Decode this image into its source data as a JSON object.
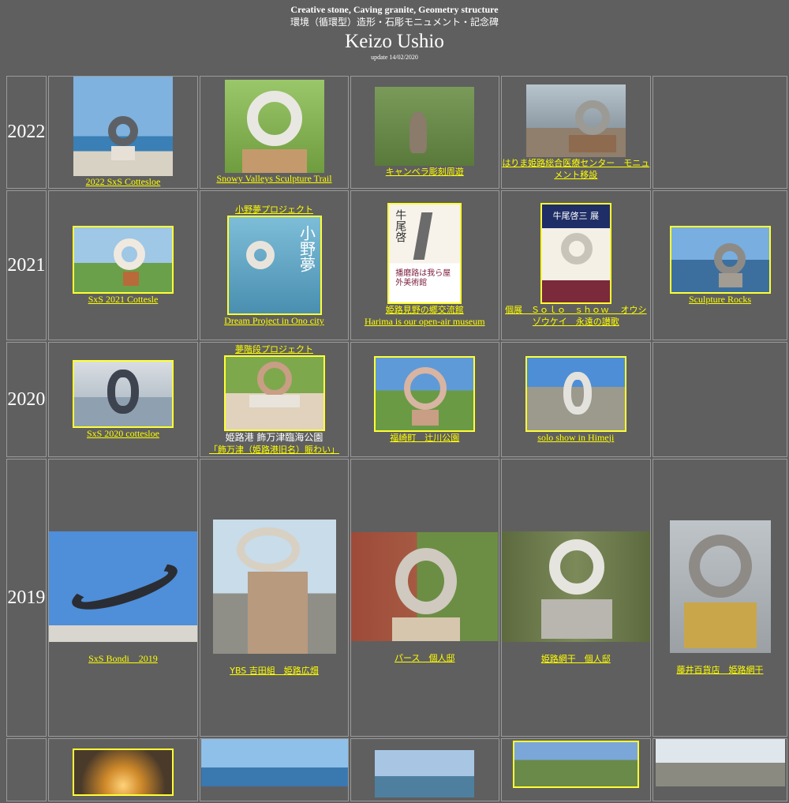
{
  "header": {
    "tagline": "Creative stone, Caving granite, Geometry structure",
    "subtitle_jp": "環境（循環型）造形・石彫モニュメント・記念碑",
    "artist": "Keizo Ushio",
    "update": "update 14/02/2020"
  },
  "rows": [
    {
      "year": "2022",
      "cells": [
        {
          "caption": "2022 SxS Cottesloe"
        },
        {
          "caption": "Snowy Valleys Sculpture Trail"
        },
        {
          "caption": "キャンベラ彫刻周遊"
        },
        {
          "caption": "はりま姫路総合医療センター　モニュメント移設"
        },
        {
          "caption": ""
        }
      ]
    },
    {
      "year": "2021",
      "cells": [
        {
          "caption": "SxS 2021 Cottesle"
        },
        {
          "heading": "小野夢プロジェクト",
          "caption": "Dream Project in Ono city",
          "poster_title": "小野夢"
        },
        {
          "caption": "姫路見野の郷交流館",
          "caption2": "Harima is our open-air museum",
          "poster_title": "播磨路は我ら屋外美術館",
          "poster_side": "牛尾啓"
        },
        {
          "caption": "個展　Ｓｏｌｏ　ｓｈｏｗ　 オウシゾウケイ　永遠の讃歌",
          "poster_title": "牛尾啓三 展"
        },
        {
          "caption": "Sculpture Rocks"
        }
      ]
    },
    {
      "year": "2020",
      "cells": [
        {
          "caption": "SxS 2020 cottesloe"
        },
        {
          "heading": "夢階段プロジェクト",
          "caption_plain": "姫路港 飾万津臨海公園",
          "caption": "「飾万津（姫路港旧名）賑わい」"
        },
        {
          "caption": "福崎町　辻川公園"
        },
        {
          "caption": "solo show in Himeji"
        },
        {
          "caption": ""
        }
      ]
    },
    {
      "year": "2019",
      "cells": [
        {
          "caption": "SxS Bondi　2019"
        },
        {
          "caption": "YBS 吉田組　姫路広畑"
        },
        {
          "caption": "パース　個人邸"
        },
        {
          "caption": "姫路網干　個人邸"
        },
        {
          "caption": "藤井百貨店　姫路網干"
        }
      ]
    }
  ],
  "colors": {
    "background": "#5f5f5f",
    "link": "#ffff00",
    "frame": "#ffff33"
  }
}
